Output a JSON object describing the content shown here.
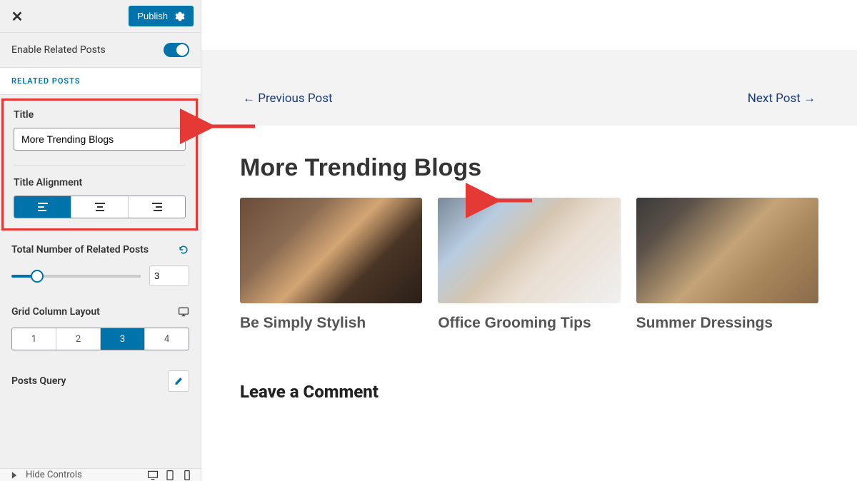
{
  "topbar": {
    "publish_label": "Publish"
  },
  "sidebar": {
    "enable_label": "Enable Related Posts",
    "section_header": "RELATED POSTS",
    "title_label": "Title",
    "title_value": "More Trending Blogs",
    "title_alignment_label": "Title Alignment",
    "total_posts_label": "Total Number of Related Posts",
    "total_posts_value": "3",
    "grid_label": "Grid Column Layout",
    "grid_options": [
      "1",
      "2",
      "3",
      "4"
    ],
    "posts_query_label": "Posts Query",
    "hide_controls_label": "Hide Controls"
  },
  "preview": {
    "prev_nav": "← Previous Post",
    "next_nav": "Next Post →",
    "main_title": "More Trending Blogs",
    "cards": [
      {
        "title": "Be Simply Stylish"
      },
      {
        "title": "Office Grooming Tips"
      },
      {
        "title": "Summer Dressings"
      }
    ],
    "comment_title": "Leave a Comment"
  }
}
